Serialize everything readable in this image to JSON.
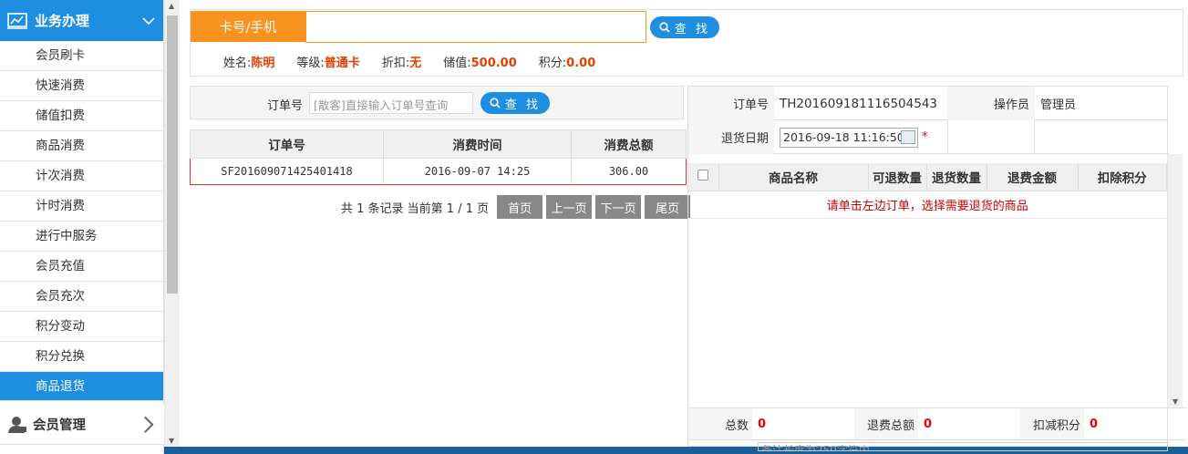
{
  "sidebar": {
    "group1_title": "业务办理",
    "items": [
      "会员刷卡",
      "快速消费",
      "储值扣费",
      "商品消费",
      "计次消费",
      "计时消费",
      "进行中服务",
      "会员充值",
      "会员充次",
      "积分变动",
      "积分兑换",
      "商品退货"
    ],
    "active_index": 11,
    "group2_title": "会员管理"
  },
  "member": {
    "card_label": "卡号/手机",
    "card_value": "",
    "search_label": "查 找",
    "name_label": "姓名:",
    "name": "陈明",
    "level_label": "等级:",
    "level": "普通卡",
    "discount_label": "折扣:",
    "discount": "无",
    "balance_label": "储值:",
    "balance": "500.00",
    "points_label": "积分:",
    "points": "0.00"
  },
  "order_search": {
    "label": "订单号",
    "placeholder": "[散客]直接输入订单号查询",
    "search_label": "查 找"
  },
  "orders": {
    "headers": [
      "订单号",
      "消费时间",
      "消费总额"
    ],
    "rows": [
      [
        "SF201609071425401418",
        "2016-09-07 14:25",
        "306.00"
      ]
    ]
  },
  "pager": {
    "summary": "共 1 条记录 当前第 1 / 1 页",
    "first": "首页",
    "prev": "上一页",
    "next": "下一页",
    "last": "尾页"
  },
  "return_form": {
    "order_no_label": "订单号",
    "order_no": "TH201609181116504543",
    "operator_label": "操作员",
    "operator": "管理员",
    "date_label": "退货日期",
    "date": "2016-09-18 11:16:50",
    "required_mark": "*"
  },
  "goods": {
    "headers": [
      "商品名称",
      "可退数量",
      "退货数量",
      "退费金额",
      "扣除积分"
    ],
    "hint": "请单击左边订单，选择需要退货的商品"
  },
  "totals": {
    "count_label": "总数",
    "count": "0",
    "refund_label": "退费总额",
    "refund": "0",
    "points_label": "扣减积分",
    "points": "0"
  },
  "remark_placeholder": "备注长度为250字符内",
  "colors": {
    "accent_blue": "#1e8ee0",
    "orange": "#f7931e",
    "value_red": "#e53e00"
  }
}
